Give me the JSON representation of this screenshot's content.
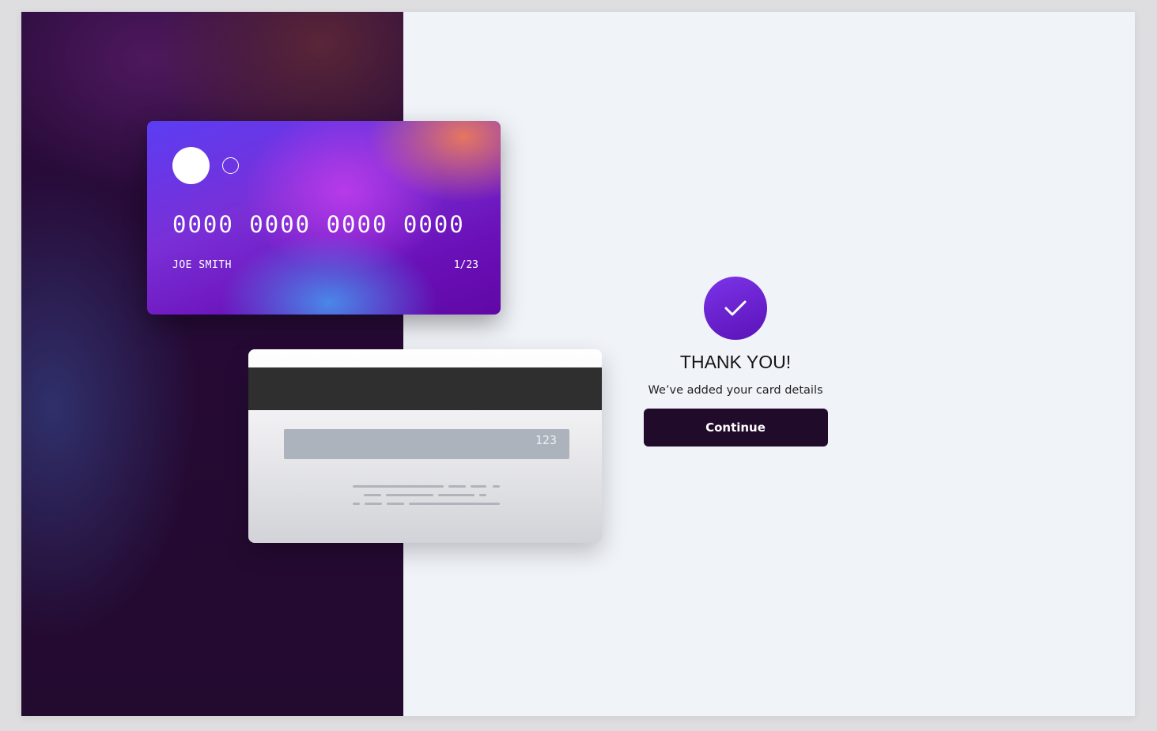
{
  "card_front": {
    "number": "0000 0000 0000 0000",
    "holder_name": "JOE SMITH",
    "expiry": "1/23",
    "logo_icon": "circle-logo-icon"
  },
  "card_back": {
    "cvc": "123"
  },
  "confirmation": {
    "icon": "checkmark-icon",
    "title": "THANK YOU!",
    "message": "We’ve added your card details",
    "continue_label": "Continue"
  },
  "colors": {
    "button_bg": "#210b2b",
    "check_circle": "#6a22cf",
    "page_bg": "#f0f3f8",
    "left_panel_bg": "#250a33"
  }
}
